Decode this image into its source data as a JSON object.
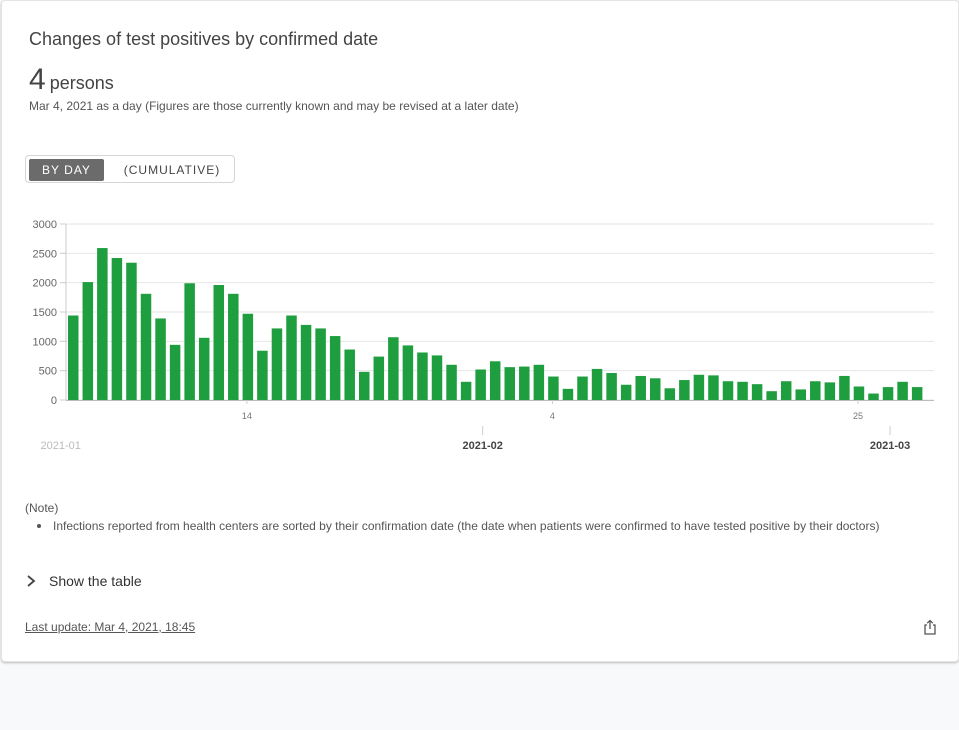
{
  "card": {
    "title": "Changes of test positives by confirmed date",
    "value": "4",
    "unit": "persons",
    "as_of": "Mar 4, 2021 as a day  (Figures are those currently known and may be revised at a later date)"
  },
  "toggle": {
    "by_day": "BY DAY",
    "cumulative": "(CUMULATIVE)"
  },
  "chart_data": {
    "type": "bar",
    "y_ticks": [
      "3000",
      "2500",
      "2000",
      "1500",
      "1000",
      "500",
      "0"
    ],
    "ylim": [
      0,
      3000
    ],
    "day_labels": [
      {
        "index": 12,
        "label": "14"
      },
      {
        "index": 33,
        "label": "4"
      },
      {
        "index": 54,
        "label": "25"
      }
    ],
    "month_labels": [
      {
        "index": -1,
        "label": "2021-01"
      },
      {
        "index": 28,
        "label": "2021-02"
      },
      {
        "index": 56,
        "label": "2021-03"
      }
    ],
    "bar_color": "#1e9e3e",
    "values": [
      1440,
      2010,
      2590,
      2420,
      2340,
      1810,
      1390,
      940,
      1990,
      1060,
      1960,
      1810,
      1470,
      840,
      1220,
      1440,
      1280,
      1220,
      1090,
      860,
      480,
      740,
      1070,
      930,
      810,
      760,
      600,
      310,
      520,
      660,
      560,
      570,
      600,
      400,
      190,
      400,
      530,
      460,
      260,
      410,
      370,
      200,
      340,
      430,
      420,
      320,
      310,
      270,
      150,
      320,
      180,
      320,
      300,
      410,
      230,
      110,
      220,
      310,
      220
    ]
  },
  "note": {
    "title": "(Note)",
    "items": [
      "Infections reported from health centers are sorted by their confirmation date (the date when patients were confirmed to have tested positive by their doctors)"
    ]
  },
  "show_table": "Show the table",
  "last_update": "Last update: Mar 4, 2021, 18:45",
  "icons": {
    "share": "share-icon",
    "chevron": "chevron-right-icon"
  }
}
